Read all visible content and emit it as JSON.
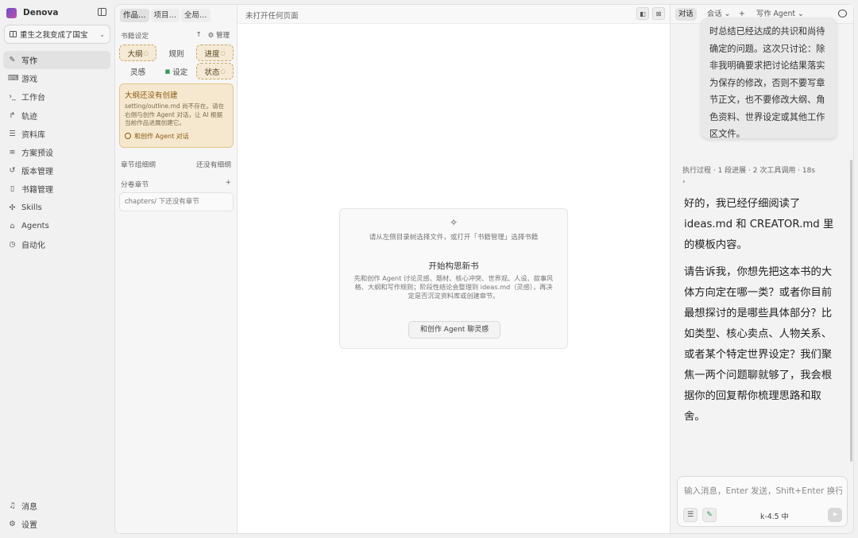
{
  "app": {
    "name": "Denova",
    "book_selector": "重生之我变成了国宝"
  },
  "sidebar": {
    "items": [
      {
        "label": "写作",
        "icon": "pen-icon",
        "active": true
      },
      {
        "label": "游戏",
        "icon": "gamepad-icon"
      },
      {
        "label": "工作台",
        "icon": "terminal-icon"
      },
      {
        "label": "轨迹",
        "icon": "route-icon"
      },
      {
        "label": "资料库",
        "icon": "database-icon"
      },
      {
        "label": "方案预设",
        "icon": "sliders-icon"
      },
      {
        "label": "版本管理",
        "icon": "history-icon"
      },
      {
        "label": "书籍管理",
        "icon": "book-icon"
      },
      {
        "label": "Skills",
        "icon": "sparkle-icon"
      },
      {
        "label": "Agents",
        "icon": "bot-icon"
      },
      {
        "label": "自动化",
        "icon": "clock-icon"
      }
    ],
    "bottom": [
      {
        "label": "消息",
        "icon": "bell-icon"
      },
      {
        "label": "设置",
        "icon": "gear-icon"
      }
    ]
  },
  "filepanel": {
    "tabs": [
      "作品…",
      "项目…",
      "全局…"
    ],
    "book_settings_label": "书籍设定",
    "manage_label": "管理",
    "tiles": [
      {
        "label": "大纲",
        "status": "◌",
        "highlight": true
      },
      {
        "label": "规则",
        "highlight": false
      },
      {
        "label": "进度",
        "status": "◌",
        "highlight": true
      },
      {
        "label": "灵感",
        "highlight": false
      },
      {
        "label": "设定",
        "highlight": false,
        "icon": true
      },
      {
        "label": "状态",
        "status": "◌",
        "highlight": true
      }
    ],
    "notice": {
      "title": "大纲还没有创建",
      "body": "setting/outline.md 尚不存在。请在右侧与创作 Agent 对话，让 AI 根据当前作品进展创建它。",
      "link": "和创作 Agent 对话"
    },
    "chapter_outline_label": "章节组细纲",
    "chapter_outline_status": "还没有细纲",
    "volumes_label": "分卷章节",
    "volumes_add": "+",
    "chapters_empty": "chapters/ 下还没有章节"
  },
  "main": {
    "tab_title": "未打开任何页面",
    "welcome": {
      "line1": "请从左侧目录树选择文件，或打开「书籍管理」选择书籍",
      "heading": "开始构思新书",
      "desc": "先和创作 Agent 讨论灵感、题材、核心冲突、世界观、人设、叙事风格、大纲和写作规则；阶段性结论会整理到 ideas.md（灵感），再决定是否沉淀资料库或创建章节。",
      "button": "和创作 Agent 聊灵感"
    }
  },
  "chat": {
    "tabs": {
      "dialog": "对话",
      "session": "会话",
      "add": "+",
      "agent": "写作 Agent"
    },
    "user_message": "时总结已经达成的共识和尚待确定的问题。这次只讨论：除非我明确要求把讨论结果落实为保存的修改，否则不要写章节正文，也不要修改大纲、角色资料、世界设定或其他工作区文件。",
    "exec_summary": "执行过程 · 1 段进展 · 2 次工具调用 · 18s",
    "reply_p1": "好的，我已经仔细阅读了 ideas.md 和 CREATOR.md 里的模板内容。",
    "reply_p2": "请告诉我，你想先把这本书的大体方向定在哪一类？或者你目前最想探讨的是哪些具体部分？比如类型、核心卖点、人物关系、或者某个特定世界设定？我们聚焦一两个问题聊就够了，我会根据你的回复帮你梳理思路和取舍。",
    "input_placeholder": "输入消息，Enter 发送，Shift+Enter 换行",
    "model": "k-4.5 中"
  }
}
